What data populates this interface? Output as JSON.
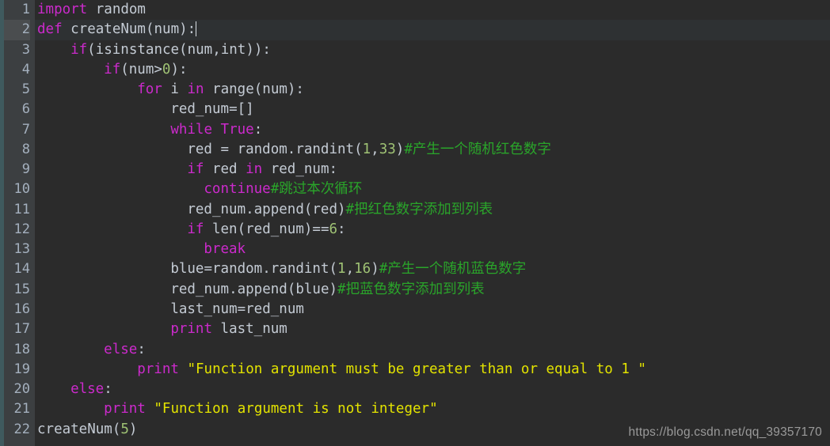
{
  "editor": {
    "language": "Python",
    "total_lines": 22,
    "active_line": 2,
    "theme": {
      "background": "#2b2b2b",
      "gutter_background": "#3c3f41",
      "active_line_background": "#2e3133",
      "line_number_color": "#a4b0be",
      "text_color": "#c4cbd4",
      "keyword_color": "#cc2acc",
      "string_color": "#e3e300",
      "number_color": "#9fc274",
      "comment_color": "#2aa52a",
      "edge_strip_color": "#3f5a5e",
      "caret_color": "#d8dee4"
    }
  },
  "lines": [
    {
      "number": "1",
      "indent": 0,
      "tokens": [
        {
          "t": "import",
          "c": "kw"
        },
        {
          "t": " random",
          "c": "id"
        }
      ]
    },
    {
      "number": "2",
      "indent": 0,
      "active": true,
      "caret": true,
      "tokens": [
        {
          "t": "def",
          "c": "kw"
        },
        {
          "t": " createNum(num):",
          "c": "id"
        }
      ]
    },
    {
      "number": "3",
      "indent": 4,
      "tokens": [
        {
          "t": "if",
          "c": "kw"
        },
        {
          "t": "(isinstance(num,int)):",
          "c": "id"
        }
      ]
    },
    {
      "number": "4",
      "indent": 8,
      "tokens": [
        {
          "t": "if",
          "c": "kw"
        },
        {
          "t": "(num>",
          "c": "id"
        },
        {
          "t": "0",
          "c": "num"
        },
        {
          "t": "):",
          "c": "id"
        }
      ]
    },
    {
      "number": "5",
      "indent": 12,
      "tokens": [
        {
          "t": "for",
          "c": "kw"
        },
        {
          "t": " i ",
          "c": "id"
        },
        {
          "t": "in",
          "c": "kw"
        },
        {
          "t": " range(num):",
          "c": "id"
        }
      ]
    },
    {
      "number": "6",
      "indent": 16,
      "tokens": [
        {
          "t": "red_num=[]",
          "c": "id"
        }
      ]
    },
    {
      "number": "7",
      "indent": 16,
      "tokens": [
        {
          "t": "while",
          "c": "kw"
        },
        {
          "t": " ",
          "c": "id"
        },
        {
          "t": "True",
          "c": "kw"
        },
        {
          "t": ":",
          "c": "id"
        }
      ]
    },
    {
      "number": "8",
      "indent": 18,
      "tokens": [
        {
          "t": "red = random.randint(",
          "c": "id"
        },
        {
          "t": "1",
          "c": "num"
        },
        {
          "t": ",",
          "c": "id"
        },
        {
          "t": "33",
          "c": "num"
        },
        {
          "t": ")",
          "c": "id"
        },
        {
          "t": "#",
          "c": "comh"
        },
        {
          "t": "产生一个随机红色数字",
          "c": "com"
        }
      ]
    },
    {
      "number": "9",
      "indent": 18,
      "tokens": [
        {
          "t": "if",
          "c": "kw"
        },
        {
          "t": " red ",
          "c": "id"
        },
        {
          "t": "in",
          "c": "kw"
        },
        {
          "t": " red_num:",
          "c": "id"
        }
      ]
    },
    {
      "number": "10",
      "indent": 20,
      "tokens": [
        {
          "t": "continue",
          "c": "kw"
        },
        {
          "t": "#",
          "c": "comh"
        },
        {
          "t": "跳过本次循环",
          "c": "com"
        }
      ]
    },
    {
      "number": "11",
      "indent": 18,
      "tokens": [
        {
          "t": "red_num.append(red)",
          "c": "id"
        },
        {
          "t": "#",
          "c": "comh"
        },
        {
          "t": "把红色数字添加到列表",
          "c": "com"
        }
      ]
    },
    {
      "number": "12",
      "indent": 18,
      "tokens": [
        {
          "t": "if",
          "c": "kw"
        },
        {
          "t": " len(red_num)==",
          "c": "id"
        },
        {
          "t": "6",
          "c": "num"
        },
        {
          "t": ":",
          "c": "id"
        }
      ]
    },
    {
      "number": "13",
      "indent": 20,
      "tokens": [
        {
          "t": "break",
          "c": "kw"
        }
      ]
    },
    {
      "number": "14",
      "indent": 16,
      "tokens": [
        {
          "t": "blue=random.randint(",
          "c": "id"
        },
        {
          "t": "1",
          "c": "num"
        },
        {
          "t": ",",
          "c": "id"
        },
        {
          "t": "16",
          "c": "num"
        },
        {
          "t": ")",
          "c": "id"
        },
        {
          "t": "#",
          "c": "comh"
        },
        {
          "t": "产生一个随机蓝色数字",
          "c": "com"
        }
      ]
    },
    {
      "number": "15",
      "indent": 16,
      "tokens": [
        {
          "t": "red_num.append(blue)",
          "c": "id"
        },
        {
          "t": "#",
          "c": "comh"
        },
        {
          "t": "把蓝色数字添加到列表",
          "c": "com"
        }
      ]
    },
    {
      "number": "16",
      "indent": 16,
      "tokens": [
        {
          "t": "last_num=red_num",
          "c": "id"
        }
      ]
    },
    {
      "number": "17",
      "indent": 16,
      "tokens": [
        {
          "t": "print",
          "c": "kw"
        },
        {
          "t": " last_num",
          "c": "id"
        }
      ]
    },
    {
      "number": "18",
      "indent": 8,
      "tokens": [
        {
          "t": "else",
          "c": "kw"
        },
        {
          "t": ":",
          "c": "id"
        }
      ]
    },
    {
      "number": "19",
      "indent": 12,
      "tokens": [
        {
          "t": "print",
          "c": "kw"
        },
        {
          "t": " ",
          "c": "id"
        },
        {
          "t": "\"Function argument must be greater than or equal to 1 \"",
          "c": "str"
        }
      ]
    },
    {
      "number": "20",
      "indent": 4,
      "tokens": [
        {
          "t": "else",
          "c": "kw"
        },
        {
          "t": ":",
          "c": "id"
        }
      ]
    },
    {
      "number": "21",
      "indent": 8,
      "tokens": [
        {
          "t": "print",
          "c": "kw"
        },
        {
          "t": " ",
          "c": "id"
        },
        {
          "t": "\"Function argument is not integer\"",
          "c": "str"
        }
      ]
    },
    {
      "number": "22",
      "indent": 0,
      "tokens": [
        {
          "t": "createNum(",
          "c": "id"
        },
        {
          "t": "5",
          "c": "num"
        },
        {
          "t": ")",
          "c": "id"
        }
      ]
    }
  ],
  "watermark": {
    "text": "https://blog.csdn.net/qq_39357170"
  }
}
